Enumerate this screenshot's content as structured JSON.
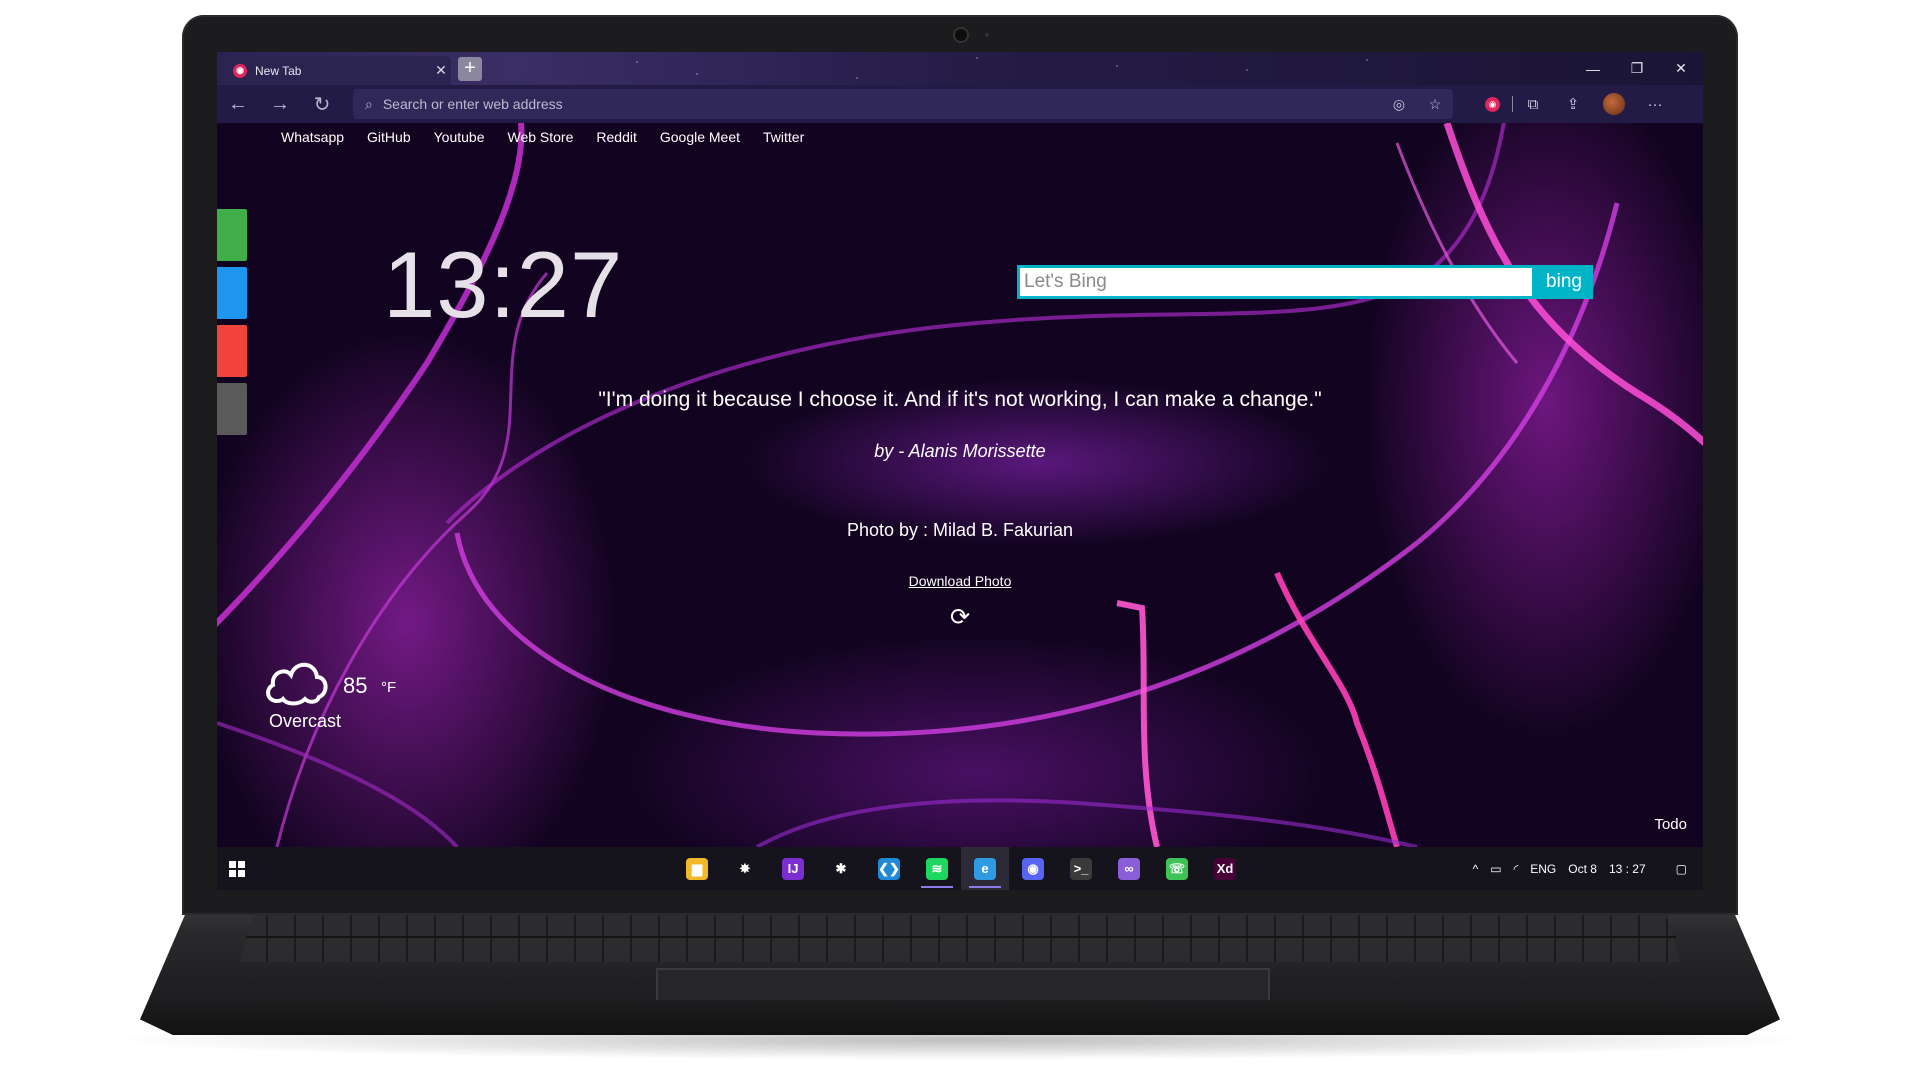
{
  "browser": {
    "tab_title": "New Tab",
    "tab_close": "✕",
    "new_tab": "+",
    "address_placeholder": "Search or enter web address",
    "window_controls": {
      "minimize": "—",
      "maximize": "❐",
      "close": "✕"
    },
    "nav": {
      "back": "←",
      "forward": "→",
      "refresh": "↻"
    }
  },
  "bookmarks": [
    "Whatsapp",
    "GitHub",
    "Youtube",
    "Web Store",
    "Reddit",
    "Google Meet",
    "Twitter"
  ],
  "side_tiles": [
    "#3fae49",
    "#1e96f0",
    "#f0443a",
    "#5a5a5a"
  ],
  "clock": "13:27",
  "search": {
    "placeholder": "Let's Bing",
    "button": "bing"
  },
  "quote": {
    "text": "\"I'm doing it because I choose it. And if it's not working, I can make a change.\"",
    "author": "by - Alanis Morissette"
  },
  "photo": {
    "credit": "Photo by : Milad B. Fakurian",
    "download": "Download Photo",
    "refresh_icon": "⟳"
  },
  "weather": {
    "temperature": "85",
    "unit": "°F",
    "condition": "Overcast"
  },
  "todo": "Todo",
  "taskbar": {
    "apps": [
      {
        "name": "file-explorer-icon",
        "glyph": "▆",
        "bg": "#f3b82a"
      },
      {
        "name": "spider-app-icon",
        "glyph": "✸",
        "bg": "#15131c"
      },
      {
        "name": "jetbrains-icon",
        "glyph": "IJ",
        "bg": "#7b2fd0"
      },
      {
        "name": "jmeter-icon",
        "glyph": "✱",
        "bg": "#15131c"
      },
      {
        "name": "vscode-icon",
        "glyph": "❮❯",
        "bg": "#1e8ad6"
      },
      {
        "name": "spotify-icon",
        "glyph": "≋",
        "bg": "#1ed760"
      },
      {
        "name": "edge-icon",
        "glyph": "e",
        "bg": "#2f9be4"
      },
      {
        "name": "discord-icon",
        "glyph": "◉",
        "bg": "#5865f2"
      },
      {
        "name": "terminal-icon",
        "glyph": ">_",
        "bg": "#3a3a3a"
      },
      {
        "name": "visual-studio-icon",
        "glyph": "∞",
        "bg": "#8a5ed8"
      },
      {
        "name": "whatsapp-icon",
        "glyph": "☏",
        "bg": "#3ec356"
      },
      {
        "name": "adobe-xd-icon",
        "glyph": "Xd",
        "bg": "#470137"
      }
    ],
    "tray": {
      "chevron": "^",
      "language": "ENG",
      "date": "Oct 8",
      "time": "13 : 27"
    }
  }
}
